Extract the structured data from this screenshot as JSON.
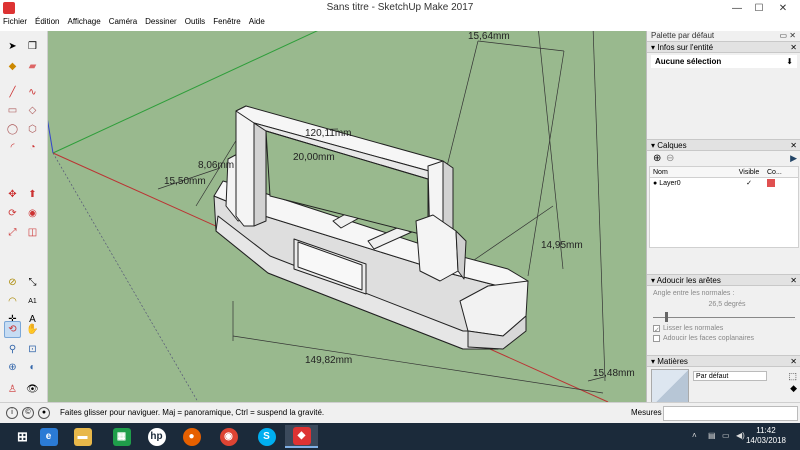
{
  "window": {
    "title": "Sans titre - SketchUp Make 2017"
  },
  "menu": [
    "Fichier",
    "Édition",
    "Affichage",
    "Caméra",
    "Dessiner",
    "Outils",
    "Fenêtre",
    "Aide"
  ],
  "viewport": {
    "dimensions": [
      "15,64mm",
      "120,11mm",
      "8,06mm",
      "20,00mm",
      "15,50mm",
      "14,95mm",
      "149,82mm",
      "15,48mm"
    ]
  },
  "panel": {
    "title": "Palette par défaut",
    "entity": {
      "header": "Infos sur l'entité",
      "selection": "Aucune sélection"
    },
    "layers": {
      "header": "Calques",
      "columns": [
        "Nom",
        "Visible",
        "Co..."
      ],
      "rows": [
        {
          "name": "Layer0",
          "visible": "✓",
          "color": "#e05050"
        }
      ]
    },
    "soften": {
      "header": "Adoucir les arêtes",
      "angle_label": "Angle entre les normales :",
      "angle_value": "26,5",
      "angle_unit": "degrés",
      "option1": "Lisser les normales",
      "option2": "Adoucir les faces coplanaires"
    },
    "materials": {
      "header": "Matières",
      "name": "Par défaut"
    }
  },
  "status": {
    "text": "Faites glisser pour naviguer. Maj = panoramique, Ctrl =  suspend la gravité.",
    "measures_label": "Mesures"
  },
  "taskbar": {
    "time": "11:42",
    "date": "14/03/2018"
  },
  "colors": {
    "viewport": "#99b98e",
    "taskbar": "#1b2a3a",
    "model": "#f4f4f4"
  }
}
